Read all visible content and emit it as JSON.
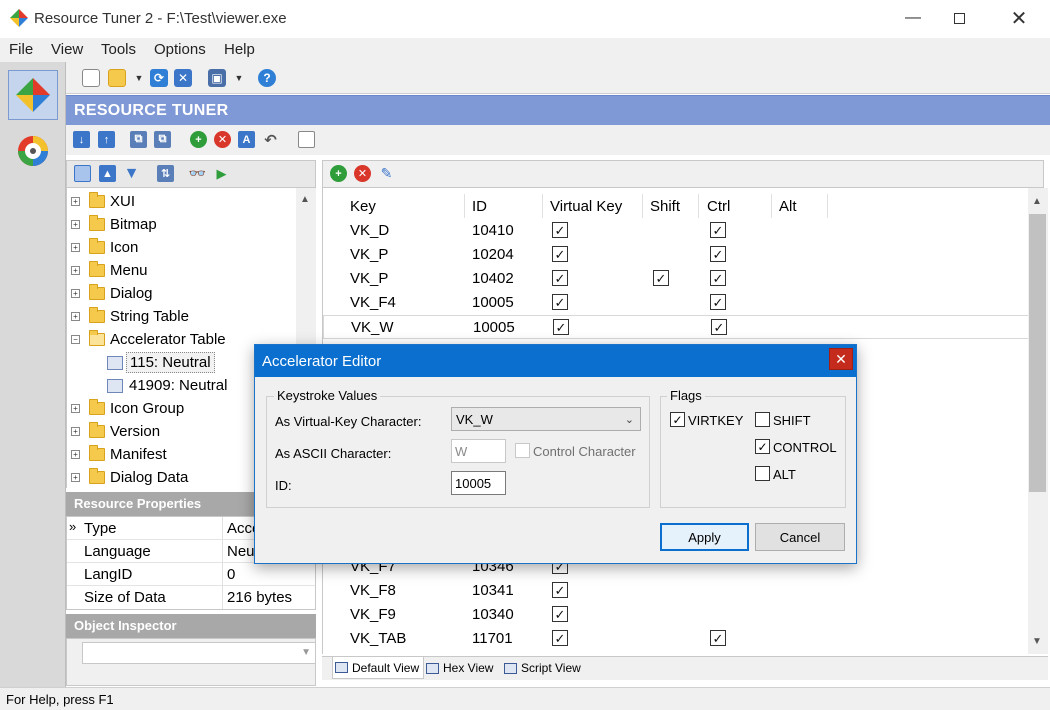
{
  "window": {
    "title": "Resource Tuner 2 - F:\\Test\\viewer.exe"
  },
  "menu": [
    "File",
    "View",
    "Tools",
    "Options",
    "Help"
  ],
  "banner": {
    "title": "RESOURCE TUNER"
  },
  "tree": {
    "items": [
      {
        "label": "XUI",
        "type": "folder"
      },
      {
        "label": "Bitmap",
        "type": "folder"
      },
      {
        "label": "Icon",
        "type": "folder"
      },
      {
        "label": "Menu",
        "type": "folder"
      },
      {
        "label": "Dialog",
        "type": "folder"
      },
      {
        "label": "String Table",
        "type": "folder"
      },
      {
        "label": "Accelerator Table",
        "type": "folder-open"
      },
      {
        "label": "115: Neutral",
        "type": "child"
      },
      {
        "label": "41909: Neutral",
        "type": "child"
      },
      {
        "label": "Icon Group",
        "type": "folder"
      },
      {
        "label": "Version",
        "type": "folder"
      },
      {
        "label": "Manifest",
        "type": "folder"
      },
      {
        "label": "Dialog Data",
        "type": "folder"
      }
    ]
  },
  "properties": {
    "title": "Resource Properties",
    "rows": [
      {
        "key": "Type",
        "value": "Acce"
      },
      {
        "key": "Language",
        "value": "Neu"
      },
      {
        "key": "LangID",
        "value": "0"
      },
      {
        "key": "Size of Data",
        "value": "216 bytes"
      }
    ]
  },
  "inspector": {
    "title": "Object Inspector"
  },
  "grid": {
    "headers": {
      "key": "Key",
      "id": "ID",
      "virtual": "Virtual Key",
      "shift": "Shift",
      "ctrl": "Ctrl",
      "alt": "Alt"
    },
    "rows_top": [
      {
        "key": "VK_D",
        "id": "10410",
        "v": true,
        "s": false,
        "c": true
      },
      {
        "key": "VK_P",
        "id": "10204",
        "v": true,
        "s": false,
        "c": true
      },
      {
        "key": "VK_P",
        "id": "10402",
        "v": true,
        "s": true,
        "c": true
      },
      {
        "key": "VK_F4",
        "id": "10005",
        "v": true,
        "s": false,
        "c": true
      },
      {
        "key": "VK_W",
        "id": "10005",
        "v": true,
        "s": false,
        "c": true
      }
    ],
    "rows_bottom": [
      {
        "key": "VK_F7",
        "id": "10346",
        "v": true,
        "s": false,
        "c": false
      },
      {
        "key": "VK_F8",
        "id": "10341",
        "v": true,
        "s": false,
        "c": false
      },
      {
        "key": "VK_F9",
        "id": "10340",
        "v": true,
        "s": false,
        "c": false
      },
      {
        "key": "VK_TAB",
        "id": "11701",
        "v": true,
        "s": false,
        "c": true
      }
    ]
  },
  "tabs": [
    "Default View",
    "Hex View",
    "Script View"
  ],
  "status": "For Help, press F1",
  "dialog": {
    "title": "Accelerator Editor",
    "keystroke_group": "Keystroke Values",
    "vk_label": "As Virtual-Key Character:",
    "vk_value": "VK_W",
    "ascii_label": "As ASCII Character:",
    "ascii_value": "W",
    "control_char_label": "Control Character",
    "id_label": "ID:",
    "id_value": "10005",
    "flags_group": "Flags",
    "flags": {
      "virtkey": "VIRTKEY",
      "shift": "SHIFT",
      "control": "CONTROL",
      "alt": "ALT"
    },
    "apply": "Apply",
    "cancel": "Cancel"
  },
  "colors": {
    "banner": "#7f98d6",
    "dialog_title": "#0a6fcf",
    "close_red": "#c42b1c"
  }
}
